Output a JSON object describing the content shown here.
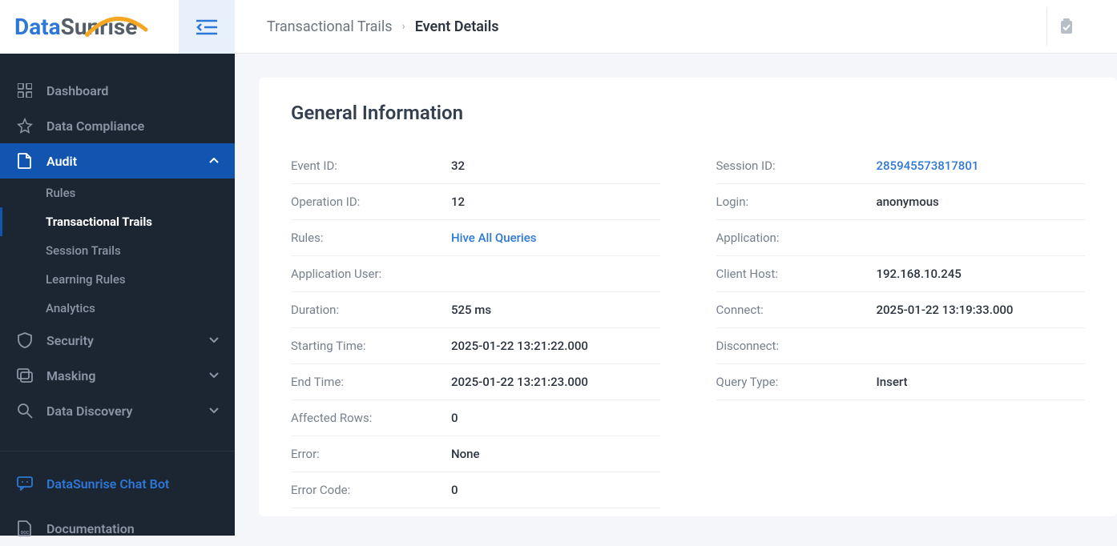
{
  "logo": {
    "part1": "Data",
    "part2": "Sunrise"
  },
  "breadcrumb": {
    "parent": "Transactional Trails",
    "current": "Event Details"
  },
  "nav": {
    "dashboard": "Dashboard",
    "data_compliance": "Data Compliance",
    "audit": "Audit",
    "audit_sub": {
      "rules": "Rules",
      "transactional_trails": "Transactional Trails",
      "session_trails": "Session Trails",
      "learning_rules": "Learning Rules",
      "analytics": "Analytics"
    },
    "security": "Security",
    "masking": "Masking",
    "data_discovery": "Data Discovery",
    "chat_bot": "DataSunrise Chat Bot",
    "documentation": "Documentation"
  },
  "section_title": "General Information",
  "left_rows": [
    {
      "label": "Event ID:",
      "value": "32",
      "link": false
    },
    {
      "label": "Operation ID:",
      "value": "12",
      "link": false
    },
    {
      "label": "Rules:",
      "value": "Hive All Queries",
      "link": true
    },
    {
      "label": "Application User:",
      "value": "",
      "link": false
    },
    {
      "label": "Duration:",
      "value": "525 ms",
      "link": false
    },
    {
      "label": "Starting Time:",
      "value": "2025-01-22 13:21:22.000",
      "link": false
    },
    {
      "label": "End Time:",
      "value": "2025-01-22 13:21:23.000",
      "link": false
    },
    {
      "label": "Affected Rows:",
      "value": "0",
      "link": false
    },
    {
      "label": "Error:",
      "value": "None",
      "link": false
    },
    {
      "label": "Error Code:",
      "value": "0",
      "link": false
    }
  ],
  "right_rows": [
    {
      "label": "Session ID:",
      "value": "285945573817801",
      "link": true
    },
    {
      "label": "Login:",
      "value": "anonymous",
      "link": false
    },
    {
      "label": "Application:",
      "value": "",
      "link": false
    },
    {
      "label": "Client Host:",
      "value": "192.168.10.245",
      "link": false
    },
    {
      "label": "Connect:",
      "value": "2025-01-22 13:19:33.000",
      "link": false
    },
    {
      "label": "Disconnect:",
      "value": "",
      "link": false
    },
    {
      "label": "Query Type:",
      "value": "Insert",
      "link": false
    }
  ]
}
